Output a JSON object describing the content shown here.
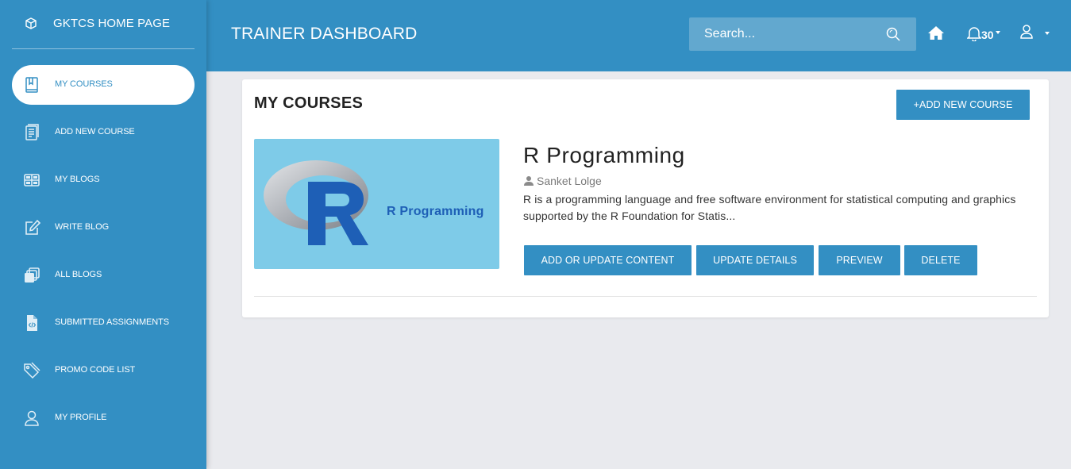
{
  "sidebar": {
    "brand": {
      "label": "GKTCS HOME PAGE",
      "icon": "cube-icon"
    },
    "items": [
      {
        "label": "MY COURSES",
        "icon": "book-icon",
        "active": true
      },
      {
        "label": "ADD NEW COURSE",
        "icon": "document-icon",
        "active": false
      },
      {
        "label": "MY BLOGS",
        "icon": "grid-icon",
        "active": false
      },
      {
        "label": "WRITE BLOG",
        "icon": "edit-icon",
        "active": false
      },
      {
        "label": "ALL BLOGS",
        "icon": "copy-icon",
        "active": false
      },
      {
        "label": "SUBMITTED ASSIGNMENTS",
        "icon": "code-file-icon",
        "active": false
      },
      {
        "label": "PROMO CODE LIST",
        "icon": "tag-icon",
        "active": false
      },
      {
        "label": "MY PROFILE",
        "icon": "user-icon",
        "active": false
      }
    ]
  },
  "header": {
    "title": "TRAINER DASHBOARD",
    "search": {
      "placeholder": "Search..."
    },
    "notifications": {
      "count": "30"
    }
  },
  "main": {
    "title": "MY COURSES",
    "add_button": "+ADD NEW COURSE",
    "course": {
      "thumbnail_text": "R Programming",
      "name": "R Programming",
      "author": "Sanket Lolge",
      "description": "R is a programming language and free software environment for statistical computing and graphics supported by the R Foundation for Statis...",
      "actions": {
        "add_update": "ADD OR UPDATE CONTENT",
        "update_details": "UPDATE DETAILS",
        "preview": "PREVIEW",
        "delete": "DELETE"
      }
    }
  },
  "colors": {
    "primary": "#338fc3",
    "search_bg": "#62a8cf",
    "page_bg": "#e9eaee",
    "thumb_bg": "#7ecbe8",
    "thumb_text": "#1e5fb6"
  }
}
